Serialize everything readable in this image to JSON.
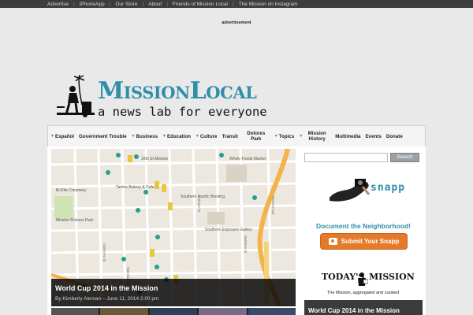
{
  "topbar": {
    "links": [
      "Advertise",
      "iPhoneApp",
      "Our Store",
      "About",
      "Friends of Mission Local",
      "The Mission on Instagram"
    ]
  },
  "ad_label": "advertisement",
  "masthead": {
    "title": "MissionLocal",
    "tagline": "a news lab for everyone"
  },
  "nav": {
    "items": [
      {
        "label": "Español",
        "dropdown": true
      },
      {
        "label": "Government Trouble",
        "dropdown": false
      },
      {
        "label": "Business",
        "dropdown": true
      },
      {
        "label": "Education",
        "dropdown": true
      },
      {
        "label": "Culture",
        "dropdown": true
      },
      {
        "label": "Transit",
        "dropdown": false
      },
      {
        "label": "Dolores Park",
        "dropdown": false
      },
      {
        "label": "Topics",
        "dropdown": true
      },
      {
        "label": "Mission History",
        "dropdown": true
      },
      {
        "label": "Multimedia",
        "dropdown": false
      },
      {
        "label": "Events",
        "dropdown": false
      },
      {
        "label": "Donate",
        "dropdown": false
      }
    ]
  },
  "feature": {
    "title": "World Cup 2014 in the Mission",
    "byline": "By Kimberly Aleman – June 11, 2014 2:00 pm",
    "map_labels": [
      "16th St Mission",
      "Whole Foods Market",
      "Bi-Rite Creamery",
      "Mission Dolores Park",
      "Tartine Bakery & Cafe",
      "Southern Pacific Brewing",
      "Southern Exposure Gallery",
      "Valencia St",
      "Guerrero St",
      "Folsom St",
      "Harrison St",
      "Potrero Ave"
    ]
  },
  "sidebar": {
    "search_button": "Search",
    "search_placeholder": "",
    "snapp_brand": "snapp",
    "document_heading": "Document the Neighborhood!",
    "submit_label": "Submit Your Snapp",
    "today_logo_line1": "TODAY'S",
    "today_logo_line2": "MISSION",
    "today_tagline": "The Mission, aggregated and curated",
    "story_title": "World Cup 2014 in the Mission"
  },
  "colors": {
    "brand": "#2f8fa8",
    "accent": "#e57a2b",
    "topbar": "#3d3d3d"
  }
}
